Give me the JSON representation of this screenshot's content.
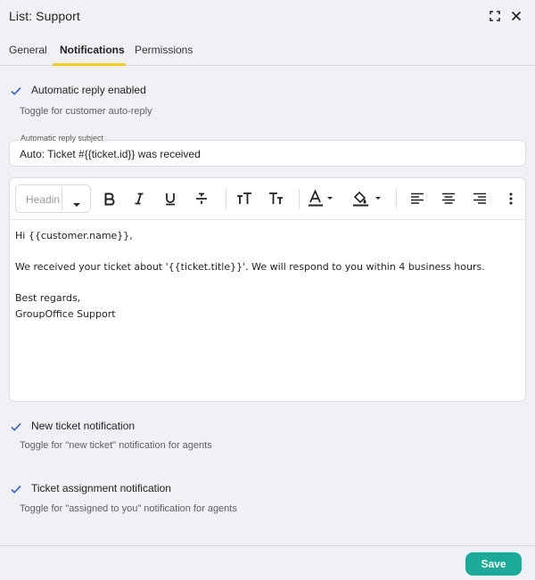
{
  "window": {
    "title": "List: Support",
    "maximize_icon": "maximize-icon",
    "close_icon": "close-icon"
  },
  "tabs": [
    {
      "label": "General",
      "active": false
    },
    {
      "label": "Notifications",
      "active": true
    },
    {
      "label": "Permissions",
      "active": false
    }
  ],
  "auto_reply": {
    "checked": true,
    "label": "Automatic reply enabled",
    "hint": "Toggle for customer auto-reply"
  },
  "subject_field": {
    "label": "Automatic reply subject",
    "value": "Auto: Ticket #{{ticket.id}} was received"
  },
  "editor": {
    "heading_placeholder": "Headin",
    "toolbar_icons": [
      "bold-icon",
      "italic-icon",
      "underline-icon",
      "strikethrough-icon",
      "font-size-increase-icon",
      "font-size-decrease-icon",
      "text-color-icon",
      "highlight-color-icon",
      "align-left-icon",
      "align-center-icon",
      "align-right-icon",
      "more-options-icon"
    ],
    "lines": [
      "Hi {{customer.name}},",
      "",
      "We received your ticket about '{{ticket.title}}'. We will respond to you within 4 business hours.",
      "",
      "Best regards,",
      "GroupOffice Support"
    ]
  },
  "new_ticket": {
    "checked": true,
    "label": "New ticket notification",
    "hint": "Toggle for \"new ticket\" notification for agents"
  },
  "assignment": {
    "checked": true,
    "label": "Ticket assignment notification",
    "hint": "Toggle for \"assigned to you\" notification for agents"
  },
  "footer": {
    "save_label": "Save"
  },
  "colors": {
    "accent_tab": "#f2cd2f",
    "save_button": "#1ba99a",
    "checkmark": "#3a68c7"
  }
}
